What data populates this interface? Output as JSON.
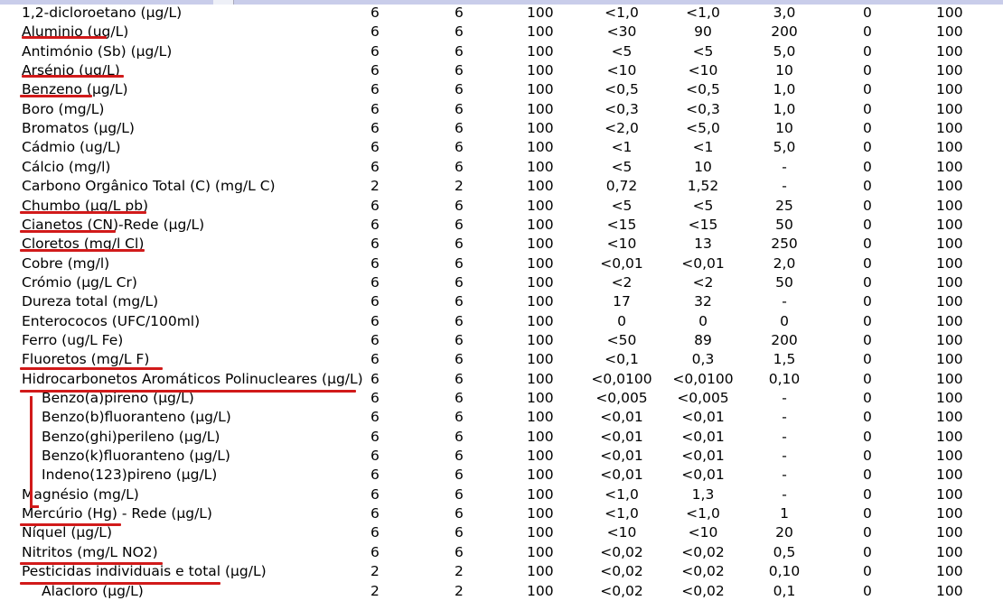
{
  "table": {
    "rows": [
      {
        "name": "1,2-dicloroetano (µg/L)",
        "sub": false,
        "c1": "6",
        "c2": "6",
        "c3": "100",
        "c4": "<1,0",
        "c5": "<1,0",
        "c6": "3,0",
        "c7": "0",
        "c8": "100"
      },
      {
        "name": "Aluminio (ug/L)",
        "sub": false,
        "c1": "6",
        "c2": "6",
        "c3": "100",
        "c4": "<30",
        "c5": "90",
        "c6": "200",
        "c7": "0",
        "c8": "100"
      },
      {
        "name": "Antimónio (Sb) (µg/L)",
        "sub": false,
        "c1": "6",
        "c2": "6",
        "c3": "100",
        "c4": "<5",
        "c5": "<5",
        "c6": "5,0",
        "c7": "0",
        "c8": "100"
      },
      {
        "name": "Arsénio (ug/L)",
        "sub": false,
        "c1": "6",
        "c2": "6",
        "c3": "100",
        "c4": "<10",
        "c5": "<10",
        "c6": "10",
        "c7": "0",
        "c8": "100"
      },
      {
        "name": "Benzeno (µg/L)",
        "sub": false,
        "c1": "6",
        "c2": "6",
        "c3": "100",
        "c4": "<0,5",
        "c5": "<0,5",
        "c6": "1,0",
        "c7": "0",
        "c8": "100"
      },
      {
        "name": "Boro  (mg/L)",
        "sub": false,
        "c1": "6",
        "c2": "6",
        "c3": "100",
        "c4": "<0,3",
        "c5": "<0,3",
        "c6": "1,0",
        "c7": "0",
        "c8": "100"
      },
      {
        "name": "Bromatos (µg/L)",
        "sub": false,
        "c1": "6",
        "c2": "6",
        "c3": "100",
        "c4": "<2,0",
        "c5": "<5,0",
        "c6": "10",
        "c7": "0",
        "c8": "100"
      },
      {
        "name": "Cádmio (ug/L)",
        "sub": false,
        "c1": "6",
        "c2": "6",
        "c3": "100",
        "c4": "<1",
        "c5": "<1",
        "c6": "5,0",
        "c7": "0",
        "c8": "100"
      },
      {
        "name": "Cálcio (mg/l)",
        "sub": false,
        "c1": "6",
        "c2": "6",
        "c3": "100",
        "c4": "<5",
        "c5": "10",
        "c6": "-",
        "c7": "0",
        "c8": "100"
      },
      {
        "name": "Carbono Orgânico Total (C)  (mg/L C)",
        "sub": false,
        "c1": "2",
        "c2": "2",
        "c3": "100",
        "c4": "0,72",
        "c5": "1,52",
        "c6": "-",
        "c7": "0",
        "c8": "100"
      },
      {
        "name": "Chumbo (µg/L pb)",
        "sub": false,
        "c1": "6",
        "c2": "6",
        "c3": "100",
        "c4": "<5",
        "c5": "<5",
        "c6": "25",
        "c7": "0",
        "c8": "100"
      },
      {
        "name": "Cianetos (CN)-Rede (µg/L)",
        "sub": false,
        "c1": "6",
        "c2": "6",
        "c3": "100",
        "c4": "<15",
        "c5": "<15",
        "c6": "50",
        "c7": "0",
        "c8": "100"
      },
      {
        "name": "Cloretos (mg/l Cl)",
        "sub": false,
        "c1": "6",
        "c2": "6",
        "c3": "100",
        "c4": "<10",
        "c5": "13",
        "c6": "250",
        "c7": "0",
        "c8": "100"
      },
      {
        "name": "Cobre (mg/l)",
        "sub": false,
        "c1": "6",
        "c2": "6",
        "c3": "100",
        "c4": "<0,01",
        "c5": "<0,01",
        "c6": "2,0",
        "c7": "0",
        "c8": "100"
      },
      {
        "name": "Crómio (µg/L Cr)",
        "sub": false,
        "c1": "6",
        "c2": "6",
        "c3": "100",
        "c4": "<2",
        "c5": "<2",
        "c6": "50",
        "c7": "0",
        "c8": "100"
      },
      {
        "name": "Dureza total (mg/L)",
        "sub": false,
        "c1": "6",
        "c2": "6",
        "c3": "100",
        "c4": "17",
        "c5": "32",
        "c6": "-",
        "c7": "0",
        "c8": "100"
      },
      {
        "name": "Enterococos (UFC/100ml)",
        "sub": false,
        "c1": "6",
        "c2": "6",
        "c3": "100",
        "c4": "0",
        "c5": "0",
        "c6": "0",
        "c7": "0",
        "c8": "100"
      },
      {
        "name": "Ferro (ug/L Fe)",
        "sub": false,
        "c1": "6",
        "c2": "6",
        "c3": "100",
        "c4": "<50",
        "c5": "89",
        "c6": "200",
        "c7": "0",
        "c8": "100"
      },
      {
        "name": "Fluoretos (mg/L F)",
        "sub": false,
        "c1": "6",
        "c2": "6",
        "c3": "100",
        "c4": "<0,1",
        "c5": "0,3",
        "c6": "1,5",
        "c7": "0",
        "c8": "100"
      },
      {
        "name": "Hidrocarbonetos Aromáticos Polinucleares (µg/L)",
        "sub": false,
        "c1": "6",
        "c2": "6",
        "c3": "100",
        "c4": "<0,0100",
        "c5": "<0,0100",
        "c6": "0,10",
        "c7": "0",
        "c8": "100"
      },
      {
        "name": "Benzo(a)pireno (µg/L)",
        "sub": true,
        "c1": "6",
        "c2": "6",
        "c3": "100",
        "c4": "<0,005",
        "c5": "<0,005",
        "c6": "-",
        "c7": "0",
        "c8": "100"
      },
      {
        "name": "Benzo(b)fluoranteno (µg/L)",
        "sub": true,
        "c1": "6",
        "c2": "6",
        "c3": "100",
        "c4": "<0,01",
        "c5": "<0,01",
        "c6": "-",
        "c7": "0",
        "c8": "100"
      },
      {
        "name": "Benzo(ghi)perileno (µg/L)",
        "sub": true,
        "c1": "6",
        "c2": "6",
        "c3": "100",
        "c4": "<0,01",
        "c5": "<0,01",
        "c6": "-",
        "c7": "0",
        "c8": "100"
      },
      {
        "name": "Benzo(k)fluoranteno (µg/L)",
        "sub": true,
        "c1": "6",
        "c2": "6",
        "c3": "100",
        "c4": "<0,01",
        "c5": "<0,01",
        "c6": "-",
        "c7": "0",
        "c8": "100"
      },
      {
        "name": "Indeno(123)pireno (µg/L)",
        "sub": true,
        "c1": "6",
        "c2": "6",
        "c3": "100",
        "c4": "<0,01",
        "c5": "<0,01",
        "c6": "-",
        "c7": "0",
        "c8": "100"
      },
      {
        "name": "Magnésio (mg/L)",
        "sub": false,
        "c1": "6",
        "c2": "6",
        "c3": "100",
        "c4": "<1,0",
        "c5": "1,3",
        "c6": "-",
        "c7": "0",
        "c8": "100"
      },
      {
        "name": "Mercúrio (Hg)  - Rede (µg/L)",
        "sub": false,
        "c1": "6",
        "c2": "6",
        "c3": "100",
        "c4": "<1,0",
        "c5": "<1,0",
        "c6": "1",
        "c7": "0",
        "c8": "100"
      },
      {
        "name": "Níquel (µg/L)",
        "sub": false,
        "c1": "6",
        "c2": "6",
        "c3": "100",
        "c4": "<10",
        "c5": "<10",
        "c6": "20",
        "c7": "0",
        "c8": "100"
      },
      {
        "name": "Nitritos (mg/L NO2)",
        "sub": false,
        "c1": "6",
        "c2": "6",
        "c3": "100",
        "c4": "<0,02",
        "c5": "<0,02",
        "c6": "0,5",
        "c7": "0",
        "c8": "100"
      },
      {
        "name": "Pesticidas individuais e total (µg/L)",
        "sub": false,
        "c1": "2",
        "c2": "2",
        "c3": "100",
        "c4": "<0,02",
        "c5": "<0,02",
        "c6": "0,10",
        "c7": "0",
        "c8": "100"
      },
      {
        "name": "Alacloro (µg/L)",
        "sub": true,
        "c1": "2",
        "c2": "2",
        "c3": "100",
        "c4": "<0,02",
        "c5": "<0,02",
        "c6": "0,1",
        "c7": "0",
        "c8": "100"
      }
    ]
  },
  "annotation": {
    "color": "#d11a1a"
  }
}
